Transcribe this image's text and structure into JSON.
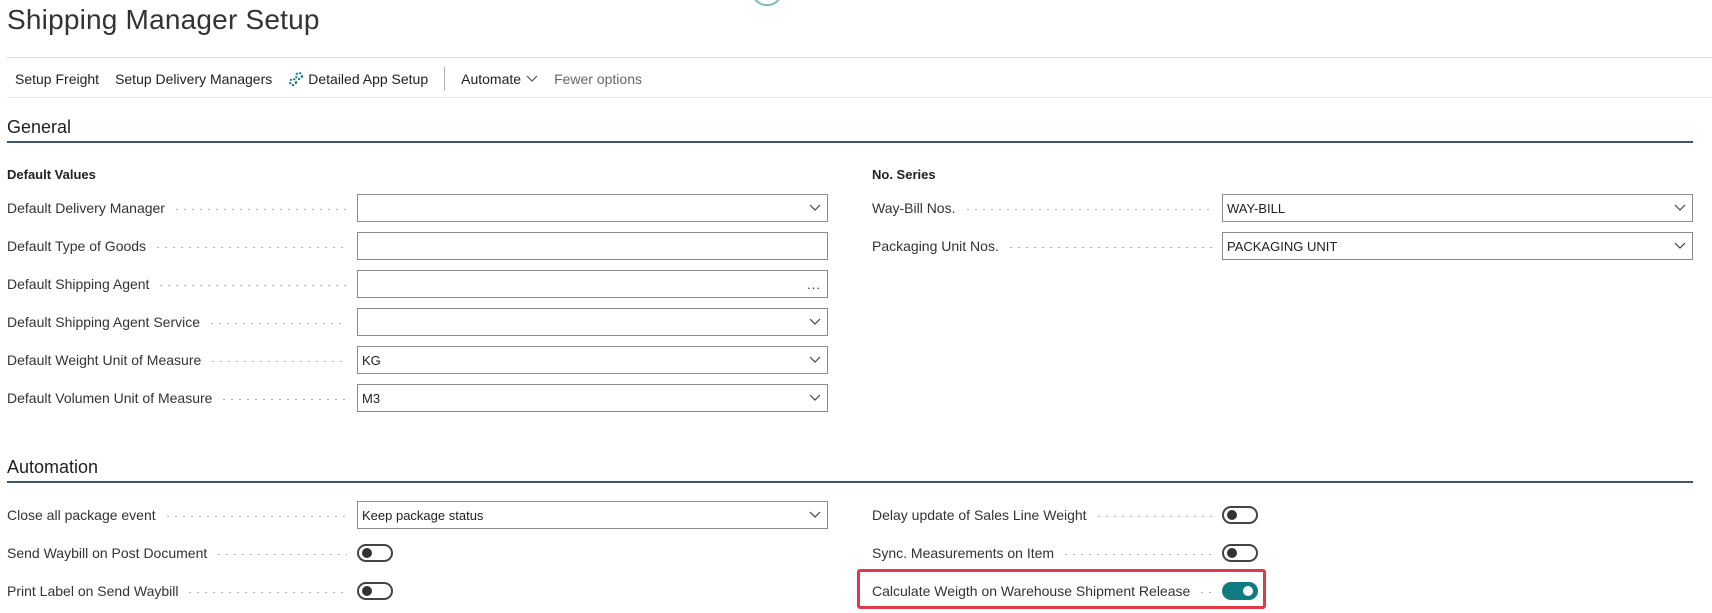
{
  "page": {
    "title": "Shipping Manager Setup"
  },
  "actions": {
    "setup_freight": "Setup Freight",
    "setup_delivery_managers": "Setup Delivery Managers",
    "detailed_app_setup": "Detailed App Setup",
    "automate": "Automate",
    "fewer_options": "Fewer options"
  },
  "general": {
    "title": "General",
    "default_values": {
      "title": "Default Values",
      "fields": [
        {
          "label": "Default Delivery Manager",
          "value": "",
          "control": "dropdown"
        },
        {
          "label": "Default Type of Goods",
          "value": "",
          "control": "text"
        },
        {
          "label": "Default Shipping Agent",
          "value": "",
          "control": "lookup",
          "button": "..."
        },
        {
          "label": "Default Shipping Agent Service",
          "value": "",
          "control": "dropdown"
        },
        {
          "label": "Default Weight Unit of Measure",
          "value": "KG",
          "control": "dropdown"
        },
        {
          "label": "Default Volumen Unit of Measure",
          "value": "M3",
          "control": "dropdown"
        }
      ]
    },
    "no_series": {
      "title": "No. Series",
      "fields": [
        {
          "label": "Way-Bill Nos.",
          "value": "WAY-BILL",
          "control": "dropdown"
        },
        {
          "label": "Packaging Unit Nos.",
          "value": "PACKAGING UNIT",
          "control": "dropdown"
        }
      ]
    }
  },
  "automation": {
    "title": "Automation",
    "left": [
      {
        "label": "Close all package event",
        "value": "Keep package status",
        "control": "dropdown"
      },
      {
        "label": "Send Waybill on Post Document",
        "on": false,
        "control": "toggle"
      },
      {
        "label": "Print Label on Send Waybill",
        "on": false,
        "control": "toggle"
      }
    ],
    "right": [
      {
        "label": "Delay update of Sales Line Weight",
        "on": false,
        "control": "toggle"
      },
      {
        "label": "Sync. Measurements on Item",
        "on": false,
        "control": "toggle"
      },
      {
        "label": "Calculate Weigth on Warehouse Shipment Release",
        "on": true,
        "control": "toggle",
        "highlighted": true
      }
    ]
  },
  "colors": {
    "accent": "#0f7c7f",
    "section_rule": "#415563",
    "highlight": "#e0394a"
  }
}
